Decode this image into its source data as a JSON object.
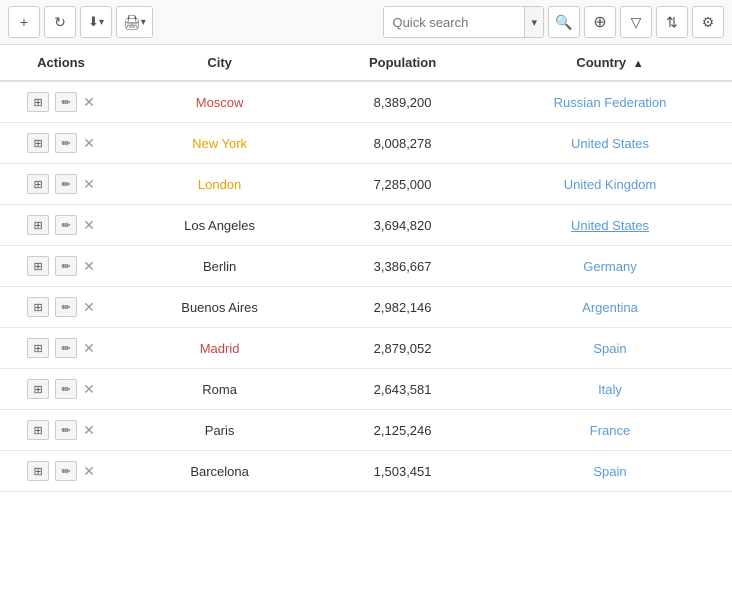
{
  "toolbar": {
    "add_label": "+",
    "refresh_label": "↻",
    "export_label": "⬇",
    "print_label": "🖨",
    "search_placeholder": "Quick search",
    "dropdown_arrow": "▾",
    "search_icon": "🔍",
    "search2_icon": "⌕",
    "filter_icon": "≡",
    "sort_icon": "⇅",
    "settings_icon": "⚙"
  },
  "table": {
    "headers": {
      "actions": "Actions",
      "city": "City",
      "population": "Population",
      "country": "Country"
    },
    "rows": [
      {
        "city": "Moscow",
        "city_style": "red",
        "population": "8,389,200",
        "country": "Russian Federation",
        "country_style": "link"
      },
      {
        "city": "New York",
        "city_style": "orange",
        "population": "8,008,278",
        "country": "United States",
        "country_style": "link"
      },
      {
        "city": "London",
        "city_style": "orange",
        "population": "7,285,000",
        "country": "United Kingdom",
        "country_style": "link"
      },
      {
        "city": "Los Angeles",
        "city_style": "normal",
        "population": "3,694,820",
        "country": "United States",
        "country_style": "link-underline"
      },
      {
        "city": "Berlin",
        "city_style": "normal",
        "population": "3,386,667",
        "country": "Germany",
        "country_style": "link"
      },
      {
        "city": "Buenos Aires",
        "city_style": "normal",
        "population": "2,982,146",
        "country": "Argentina",
        "country_style": "link"
      },
      {
        "city": "Madrid",
        "city_style": "red",
        "population": "2,879,052",
        "country": "Spain",
        "country_style": "link"
      },
      {
        "city": "Roma",
        "city_style": "normal",
        "population": "2,643,581",
        "country": "Italy",
        "country_style": "link"
      },
      {
        "city": "Paris",
        "city_style": "normal",
        "population": "2,125,246",
        "country": "France",
        "country_style": "link"
      },
      {
        "city": "Barcelona",
        "city_style": "normal",
        "population": "1,503,451",
        "country": "Spain",
        "country_style": "link"
      }
    ]
  }
}
